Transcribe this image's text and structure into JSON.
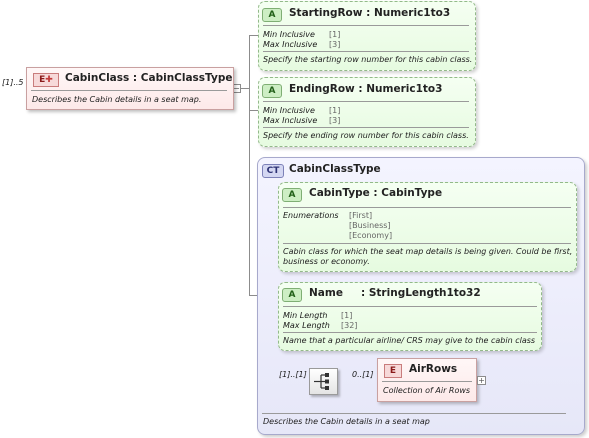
{
  "root": {
    "multiplicity": "[1]..5",
    "badge": "E",
    "title": "CabinClass : CabinClassType",
    "description": "Describes the Cabin details in a seat map."
  },
  "starting_row": {
    "badge": "A",
    "title": "StartingRow : Numeric1to3",
    "min_label": "Min Inclusive",
    "min_value": "[1]",
    "max_label": "Max Inclusive",
    "max_value": "[3]",
    "description": "Specify the starting row number for this cabin class."
  },
  "ending_row": {
    "badge": "A",
    "title": "EndingRow : Numeric1to3",
    "min_label": "Min Inclusive",
    "min_value": "[1]",
    "max_label": "Max Inclusive",
    "max_value": "[3]",
    "description": "Specify the ending row number for this cabin class."
  },
  "complex_type": {
    "badge": "CT",
    "title": "CabinClassType",
    "description": "Describes the Cabin details in a seat map"
  },
  "cabin_type": {
    "badge": "A",
    "title": "CabinType : CabinType",
    "enum_label": "Enumerations",
    "enum_values": [
      "[First]",
      "[Business]",
      "[Economy]"
    ],
    "description_line1": "Cabin class for which the seat map details is being given. Could be first,",
    "description_line2": "business or economy."
  },
  "name_attr": {
    "badge": "A",
    "title": "Name",
    "type": ": StringLength1to32",
    "min_label": "Min Length",
    "min_value": "[1]",
    "max_label": "Max Length",
    "max_value": "[32]",
    "description": "Name that a particular airline/ CRS may give to the  cabin class"
  },
  "sequence": {
    "multiplicity": "[1]..[1]",
    "child_multiplicity": "0..[1]"
  },
  "air_rows": {
    "badge": "E",
    "title": "AirRows",
    "description": "Collection of Air Rows"
  },
  "icons": {
    "collapse": "−",
    "expand": "+"
  }
}
